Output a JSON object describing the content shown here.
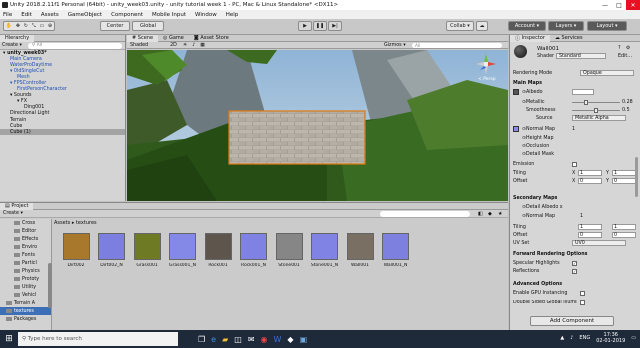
{
  "window": {
    "title": "Unity 2018.2.11f1 Personal (64bit) - unity_week03.unity - unity tutorial week 1 - PC, Mac & Linux Standalone* <DX11>",
    "controls": [
      "—",
      "□",
      "✕"
    ]
  },
  "menu": [
    "File",
    "Edit",
    "Assets",
    "GameObject",
    "Component",
    "Mobile Input",
    "Window",
    "Help"
  ],
  "toolbar": {
    "center": "Center",
    "global": "Global",
    "collab": "Collab ▾",
    "account": "Account ▾",
    "layers": "Layers ▾",
    "layout": "Layout ▾"
  },
  "hierarchy": {
    "tab": "Hierarchy",
    "create": "Create ▾",
    "search_placeholder": "All",
    "items": [
      {
        "label": "▾ unity_week03*",
        "indent": 0,
        "blue": false,
        "bold": true
      },
      {
        "label": "Main Camera",
        "indent": 1,
        "blue": true
      },
      {
        "label": "WaterProDaytime",
        "indent": 1,
        "blue": true
      },
      {
        "label": "▾ 0ldSingleCut",
        "indent": 1,
        "blue": true
      },
      {
        "label": "Mesh",
        "indent": 2,
        "blue": true
      },
      {
        "label": "▾ FPSController",
        "indent": 1,
        "blue": true
      },
      {
        "label": "FirstPersonCharacter",
        "indent": 2,
        "blue": true
      },
      {
        "label": "▾ Sounds",
        "indent": 1,
        "blue": false
      },
      {
        "label": "▾ FX",
        "indent": 2,
        "blue": false
      },
      {
        "label": "Ding001",
        "indent": 3,
        "blue": false
      },
      {
        "label": "Directional Light",
        "indent": 1,
        "blue": false
      },
      {
        "label": "Terrain",
        "indent": 1,
        "blue": false
      },
      {
        "label": "Cube",
        "indent": 1,
        "blue": false
      },
      {
        "label": "Cube (1)",
        "indent": 1,
        "blue": false,
        "selected": true
      }
    ]
  },
  "scene": {
    "tabs": [
      "Scene",
      "Game",
      "Asset Store"
    ],
    "shading": "Shaded",
    "mode2d": "2D",
    "gizmos": "Gizmos ▾",
    "search_placeholder": "All",
    "persp": "< Persp"
  },
  "project": {
    "tab": "Project",
    "create": "Create ▾",
    "breadcrumb": "Assets ▸ textures",
    "folders": [
      "Cross",
      "Editor",
      "Effects",
      "Enviro",
      "Fonts",
      "Particl",
      "Physics",
      "Prototy",
      "Utility",
      "Vehicl",
      "Terrain A",
      "textures",
      "Packages"
    ],
    "textures": [
      {
        "name": "Dirt002",
        "color": "#a8782c"
      },
      {
        "name": "Dirt002_N",
        "color": "#7d7fe0"
      },
      {
        "name": "Grass001",
        "color": "#6e7a24"
      },
      {
        "name": "Grass001_N",
        "color": "#8488e6"
      },
      {
        "name": "Rock001",
        "color": "#5e554c"
      },
      {
        "name": "Rock001_N",
        "color": "#7f82e2"
      },
      {
        "name": "Stone001",
        "color": "#868686"
      },
      {
        "name": "Stone001_N",
        "color": "#8083e3"
      },
      {
        "name": "Wall001",
        "color": "#7a6f63"
      },
      {
        "name": "Wall001_N",
        "color": "#7e80e0"
      }
    ]
  },
  "inspector": {
    "tabs": [
      "Inspector",
      "Services"
    ],
    "object": "Wall001",
    "shader_label": "Shader",
    "shader": "Standard",
    "rendering_mode_label": "Rendering Mode",
    "rendering_mode": "Opaque",
    "main_maps": "Main Maps",
    "albedo": "⊙Albedo",
    "metallic": "⊙Metallic",
    "metallic_val": "0.28",
    "metallic_frac": 0.28,
    "smoothness": "Smoothness",
    "smoothness_val": "0.5",
    "smoothness_frac": 0.5,
    "source_label": "Source",
    "source": "Metallic Alpha",
    "normal": "⊙Normal Map",
    "normal_val": "1",
    "height": "⊙Height Map",
    "occlusion": "⊙Occlusion",
    "detail_mask": "⊙Detail Mask",
    "emission": "Emission",
    "tiling": "Tiling",
    "offset": "Offset",
    "tx": "X",
    "tx_val": "1",
    "ty": "Y",
    "ty_val": "1",
    "ox": "X",
    "ox_val": "0",
    "oy": "Y",
    "oy_val": "0",
    "secondary": "Secondary Maps",
    "detail_albedo": "⊙Detail Albedo x",
    "normal2": "⊙Normal Map",
    "normal2_val": "1",
    "uv_set_label": "UV Set",
    "uv_set": "UV0",
    "forward": "Forward Rendering Options",
    "specular": "Specular Highlights",
    "reflections": "Reflections",
    "advanced": "Advanced Options",
    "gpu": "Enable GPU Instancing",
    "double": "Double Sided Global Illumination",
    "add_component": "Add Component"
  },
  "taskbar": {
    "search_placeholder": "Type here to search",
    "lang": "ENG",
    "time": "17:36",
    "date": "02-01-2019"
  }
}
